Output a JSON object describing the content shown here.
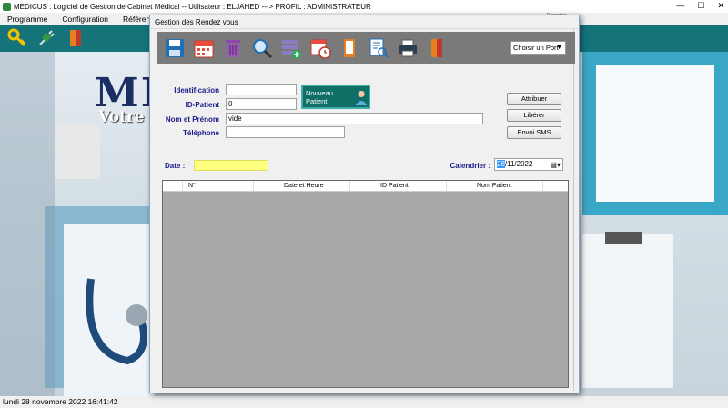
{
  "app": {
    "title": "MEDICUS : Logiciel de Gestion de Cabinet Médical  -- Utilisateur : ELJAHED ---> PROFIL : ADMINISTRATEUR",
    "menu": [
      "Programme",
      "Configuration",
      "Référentiel"
    ],
    "menu_extra": "Reporting",
    "bg_logo": "ME",
    "bg_subtitle": "Votre S",
    "status": "lundi 28 novembre 2022  16:41:42",
    "controls": [
      "—",
      "☐",
      "✕"
    ]
  },
  "dialog": {
    "title": "Gestion des Rendez vous",
    "port_select": "Choisir un Port",
    "fields": {
      "identification_label": "Identification",
      "identification_value": "",
      "id_patient_label": "ID-Patient",
      "id_patient_value": "0",
      "nom_prenom_label": "Nom et Prénom",
      "nom_prenom_value": "vide",
      "telephone_label": "Téléphone",
      "telephone_value": ""
    },
    "nouveau_patient": "Nouveau Patient",
    "buttons": {
      "attribuer": "Attribuer",
      "liberer": "Libérer",
      "sms": "Envoi SMS"
    },
    "date_label": "Date :",
    "date_value": "",
    "calendrier_label": "Calendrier :",
    "calendrier_day": "28",
    "calendrier_rest": "/11/2022",
    "grid_headers": [
      "",
      "N°",
      "Date et Heure",
      "ID Patient",
      "Nom Patient",
      ""
    ]
  }
}
